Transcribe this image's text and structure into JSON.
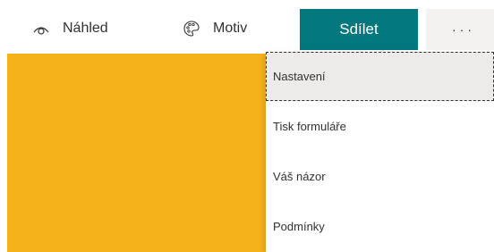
{
  "toolbar": {
    "preview": {
      "label": "Náhled",
      "icon": "eye-icon"
    },
    "theme": {
      "label": "Motiv",
      "icon": "palette-icon"
    },
    "share": {
      "label": "Sdílet",
      "color": "#03787c"
    },
    "more": {
      "label": "···",
      "icon": "more-icon"
    }
  },
  "banner": {
    "color": "#f5b21b"
  },
  "menu": {
    "items": [
      {
        "label": "Nastavení",
        "focused": true
      },
      {
        "label": "Tisk formuláře"
      },
      {
        "label": "Váš názor"
      },
      {
        "label": "Podmínky"
      }
    ]
  }
}
